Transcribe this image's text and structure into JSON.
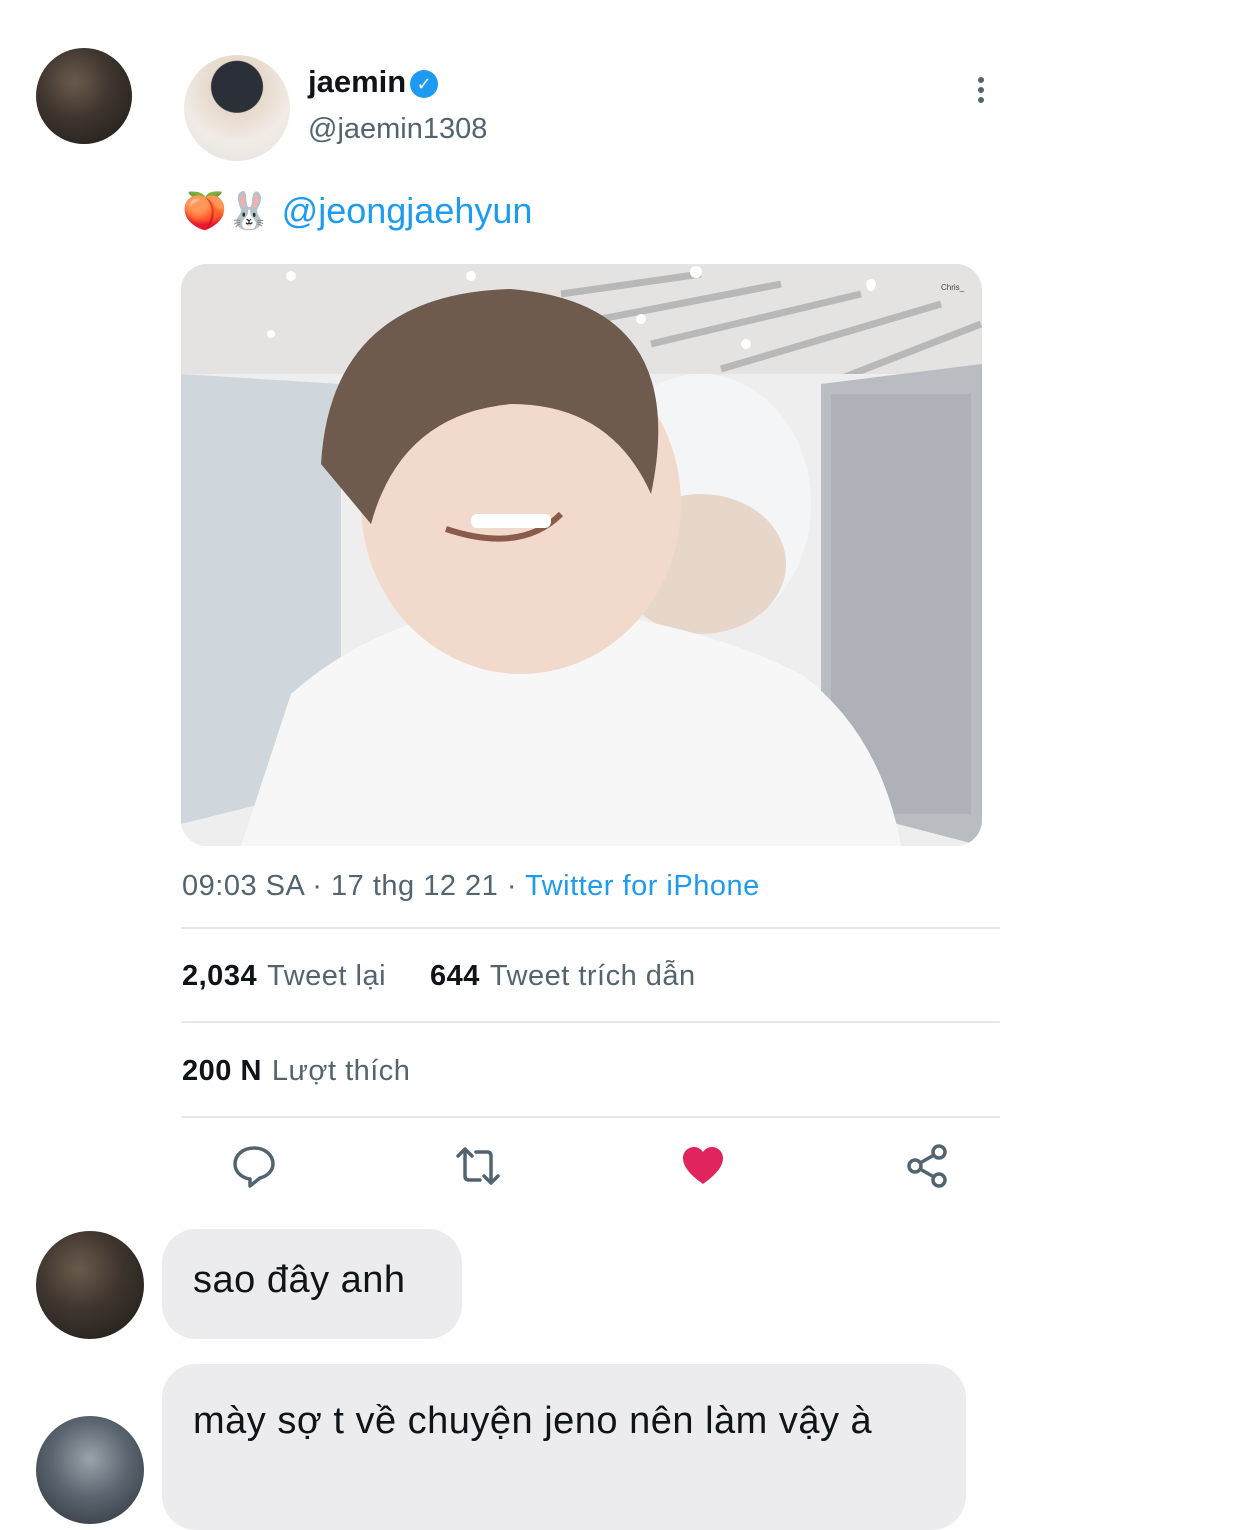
{
  "tweet": {
    "name": "jaemin",
    "verified_mark": "✓",
    "handle": "@jaemin1308",
    "emojis": "🍑🐰",
    "mention": "@jeongjaehyun",
    "time": "09:03 SA",
    "sep1": "·",
    "date": "17 thg 12 21",
    "sep2": "·",
    "source": "Twitter for iPhone",
    "watermark": "Chris_"
  },
  "stats": {
    "retweets_count": "2,034",
    "retweets_label": "Tweet lại",
    "quotes_count": "644",
    "quotes_label": "Tweet trích dẫn",
    "likes_count": "200 N",
    "likes_label": "Lượt thích"
  },
  "actions": {
    "reply_icon": "reply-icon",
    "retweet_icon": "retweet-icon",
    "like_icon": "heart-icon",
    "share_icon": "share-icon",
    "like_color": "#e0245e"
  },
  "chat": {
    "messages": [
      {
        "text": "sao đây anh"
      },
      {
        "text": "mày sợ t về chuyện jeno nên làm vậy à"
      }
    ]
  },
  "colors": {
    "link": "#1d9bf0",
    "bubble": "#ececee"
  }
}
